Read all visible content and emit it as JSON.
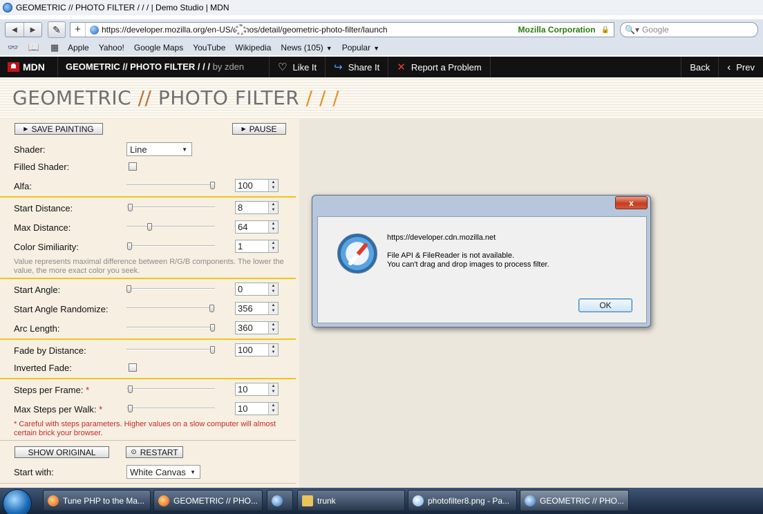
{
  "window": {
    "title": "GEOMETRIC // PHOTO FILTER / / / | Demo Studio | MDN"
  },
  "toolbar": {
    "url": "https://developer.mozilla.org/en-US/demos/detail/geometric-photo-filter/launch",
    "org": "Mozilla Corporation",
    "search_placeholder": "Google"
  },
  "bookmarks": [
    {
      "label": "Apple"
    },
    {
      "label": "Yahoo!"
    },
    {
      "label": "Google Maps"
    },
    {
      "label": "YouTube"
    },
    {
      "label": "Wikipedia"
    },
    {
      "label": "News (105)"
    },
    {
      "label": "Popular"
    }
  ],
  "mdnbar": {
    "logo": "MDN",
    "title": "GEOMETRIC // PHOTO FILTER / / /",
    "by": "by zden",
    "like": "Like It",
    "share": "Share It",
    "report": "Report a Problem",
    "back": "Back",
    "prev": "Prev"
  },
  "page": {
    "heading_a": "GEOMETRIC",
    "heading_slash1": "//",
    "heading_b": "PHOTO FILTER",
    "heading_slash2": "/ / /"
  },
  "panel": {
    "save_painting": "SAVE PAINTING",
    "pause": "PAUSE",
    "shader_label": "Shader:",
    "shader_value": "Line",
    "filled_shader_label": "Filled Shader:",
    "alfa_label": "Alfa:",
    "alfa_value": "100",
    "alfa_level": 1.0,
    "start_distance_label": "Start Distance:",
    "start_distance_value": "8",
    "start_distance_level": 0.02,
    "max_distance_label": "Max Distance:",
    "max_distance_value": "64",
    "max_distance_level": 0.25,
    "color_similiarity_label": "Color Similiarity:",
    "color_similiarity_value": "1",
    "color_similiarity_level": 0.01,
    "color_hint": "Value represents maximal difference between R/G/B components. The lower the value, the more exact color you seek.",
    "start_angle_label": "Start Angle:",
    "start_angle_value": "0",
    "start_angle_level": 0.0,
    "start_angle_randomize_label": "Start Angle Randomize:",
    "start_angle_randomize_value": "356",
    "start_angle_randomize_level": 0.99,
    "arc_length_label": "Arc Length:",
    "arc_length_value": "360",
    "arc_length_level": 1.0,
    "fade_label": "Fade by Distance:",
    "fade_value": "100",
    "fade_level": 1.0,
    "inverted_fade_label": "Inverted Fade:",
    "steps_frame_label": "Steps per Frame:",
    "steps_frame_value": "10",
    "steps_frame_level": 0.02,
    "max_steps_label": "Max Steps per Walk:",
    "max_steps_value": "10",
    "max_steps_level": 0.02,
    "star": "*",
    "steps_warning": "* Careful with steps parameters. Higher values on a slow computer will almost certain brick your browser.",
    "show_original": "SHOW ORIGINAL",
    "restart": "RESTART",
    "start_with_label": "Start with:",
    "start_with_value": "White Canvas"
  },
  "dialog": {
    "close": "x",
    "host": "https://developer.cdn.mozilla.net",
    "line1": "File API & FileReader is not available.",
    "line2": "You can't drag and drop images to process filter.",
    "ok": "OK"
  },
  "taskbar": [
    {
      "label": "Tune PHP to the Ma..."
    },
    {
      "label": "GEOMETRIC // PHO..."
    },
    {
      "label": "trunk"
    },
    {
      "label": "photofilter8.png - Pa..."
    },
    {
      "label": "GEOMETRIC // PHO..."
    }
  ]
}
